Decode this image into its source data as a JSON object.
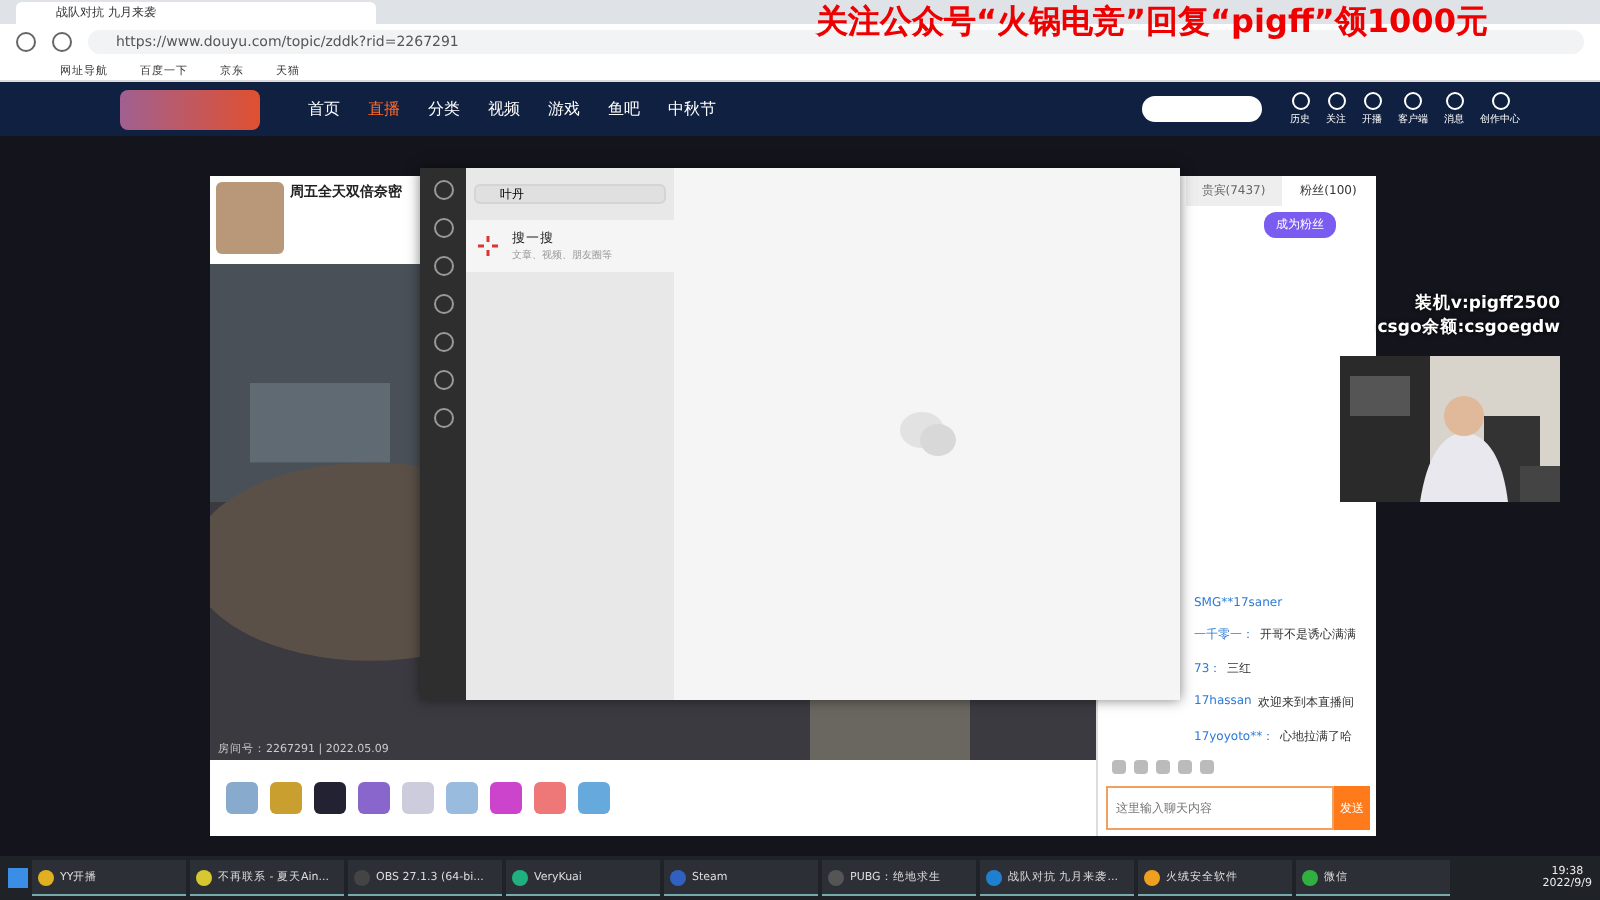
{
  "browser": {
    "tab_title": "战队对抗 九月来袭",
    "url": "https://www.douyu.com/topic/zddk?rid=2267291",
    "bookmarks": [
      "网址导航",
      "百度一下",
      "京东",
      "天猫"
    ]
  },
  "banner": "关注公众号“火锅电竞”回复“pigff”领1000元",
  "site_nav": {
    "items": [
      {
        "label": "首页",
        "selected": false
      },
      {
        "label": "直播",
        "selected": true
      },
      {
        "label": "分类",
        "selected": false
      },
      {
        "label": "视频",
        "selected": false
      },
      {
        "label": "游戏",
        "selected": false
      },
      {
        "label": "鱼吧",
        "selected": false
      },
      {
        "label": "中秋节",
        "selected": false
      }
    ],
    "actions": [
      "历史",
      "关注",
      "开播",
      "客户端",
      "消息",
      "创作中心"
    ]
  },
  "anchor_card": {
    "title": "周五全天双倍奈密"
  },
  "player": {
    "room_info": "房间号：2267291 | 2022.05.09"
  },
  "wechat": {
    "search_value": "叶丹",
    "result_title": "搜一搜",
    "result_subtitle": "文章、视频、朋友圈等"
  },
  "chat": {
    "tabs": [
      {
        "label": "贵宾(7437)",
        "selected": false
      },
      {
        "label": "粉丝(100)",
        "selected": true
      }
    ],
    "join_button": "成为粉丝",
    "messages": [
      {
        "user": "SMG**17saner"
      },
      {
        "user": "一千零一：",
        "text": "开哥不是诱心满满"
      },
      {
        "user": "73：",
        "text": "三红"
      },
      {
        "user": "17hassan",
        "text": "欢迎来到本直播间"
      },
      {
        "user": "17yoyoto**：",
        "text": "心地拉满了哈"
      }
    ],
    "input_placeholder": "这里输入聊天内容",
    "send_button": "发送"
  },
  "stream_overlay": [
    "装机v:pigff2500",
    "csgo余额:csgoegdw"
  ],
  "taskbar": {
    "apps": [
      "YY开播",
      "不再联系 - 夏天Ain...",
      "OBS 27.1.3 (64-bi...",
      "VeryKuai",
      "Steam",
      "PUBG：绝地求生",
      "战队对抗 九月来袭...",
      "火绒安全软件",
      "微信"
    ],
    "time": "19:38",
    "date": "2022/9/9"
  }
}
